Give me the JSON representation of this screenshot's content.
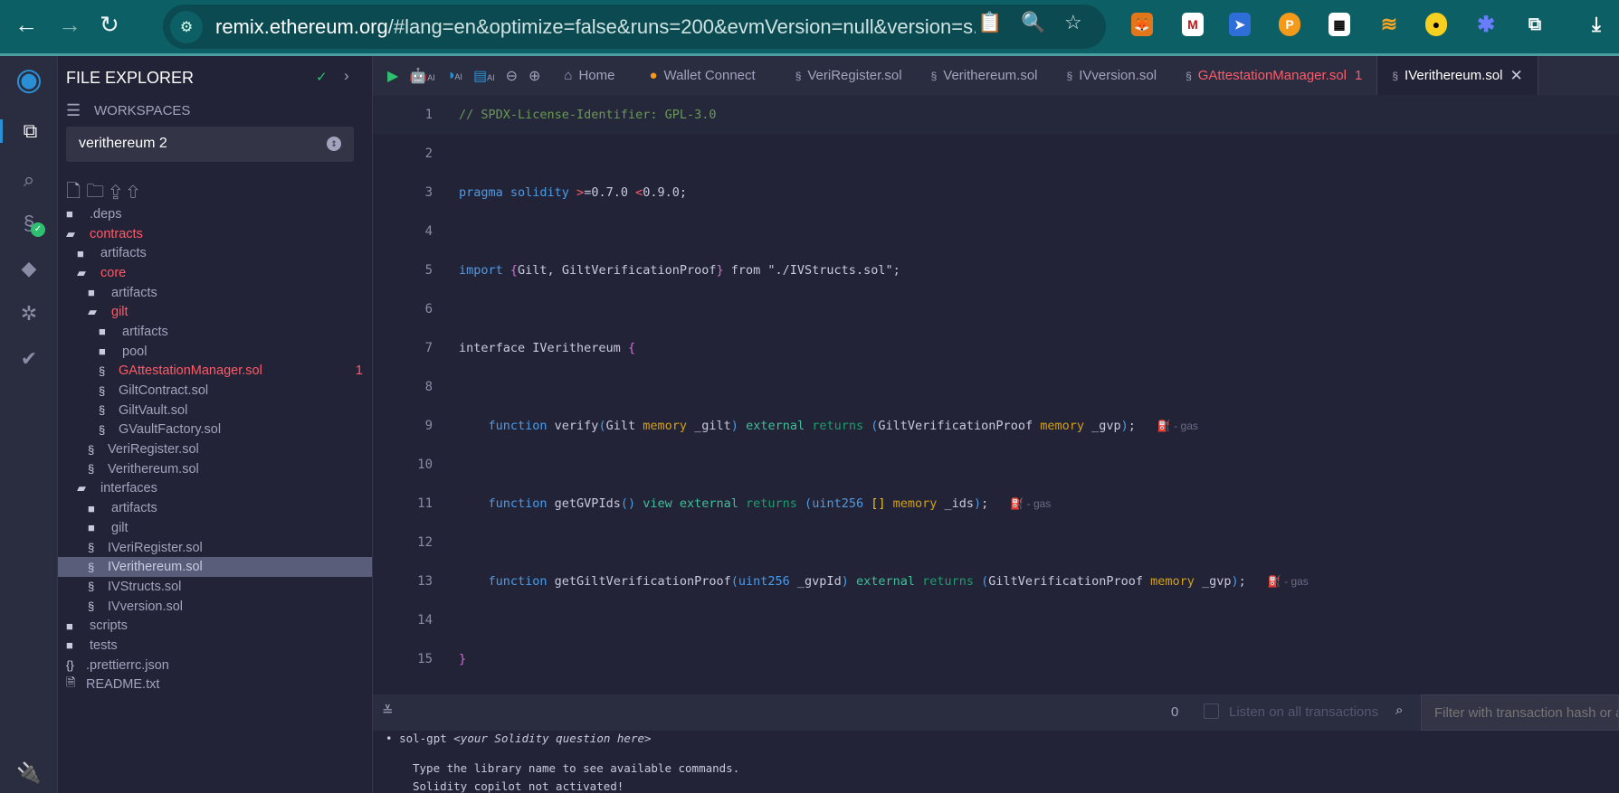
{
  "browser": {
    "url_host": "remix.ethereum.org",
    "url_rest": "/#lang=en&optimize=false&runs=200&evmVersion=null&version=s...",
    "extensions": [
      "metamask-icon",
      "mcafee-icon",
      "send-icon",
      "polkadot-icon",
      "qr-icon",
      "rss-icon",
      "bee-icon",
      "asterisk-icon",
      "puzzle-icon"
    ]
  },
  "explorer": {
    "title": "FILE EXPLORER",
    "workspaces_label": "WORKSPACES",
    "workspace": "verithereum 2",
    "tree": [
      {
        "name": ".deps",
        "type": "folder",
        "depth": 0
      },
      {
        "name": "contracts",
        "type": "folder-open",
        "depth": 0,
        "error": true
      },
      {
        "name": "artifacts",
        "type": "folder",
        "depth": 1
      },
      {
        "name": "core",
        "type": "folder-open",
        "depth": 1,
        "error": true
      },
      {
        "name": "artifacts",
        "type": "folder",
        "depth": 2
      },
      {
        "name": "gilt",
        "type": "folder-open",
        "depth": 2,
        "error": true
      },
      {
        "name": "artifacts",
        "type": "folder",
        "depth": 3
      },
      {
        "name": "pool",
        "type": "folder",
        "depth": 3
      },
      {
        "name": "GAttestationManager.sol",
        "type": "sol",
        "depth": 3,
        "error": true,
        "badge": "1"
      },
      {
        "name": "GiltContract.sol",
        "type": "sol",
        "depth": 3
      },
      {
        "name": "GiltVault.sol",
        "type": "sol",
        "depth": 3
      },
      {
        "name": "GVaultFactory.sol",
        "type": "sol",
        "depth": 3
      },
      {
        "name": "VeriRegister.sol",
        "type": "sol",
        "depth": 2
      },
      {
        "name": "Verithereum.sol",
        "type": "sol",
        "depth": 2
      },
      {
        "name": "interfaces",
        "type": "folder-open",
        "depth": 1
      },
      {
        "name": "artifacts",
        "type": "folder",
        "depth": 2
      },
      {
        "name": "gilt",
        "type": "folder",
        "depth": 2
      },
      {
        "name": "IVeriRegister.sol",
        "type": "sol",
        "depth": 2
      },
      {
        "name": "IVerithereum.sol",
        "type": "sol",
        "depth": 2,
        "selected": true
      },
      {
        "name": "IVStructs.sol",
        "type": "sol",
        "depth": 2
      },
      {
        "name": "IVversion.sol",
        "type": "sol",
        "depth": 2
      },
      {
        "name": "scripts",
        "type": "folder",
        "depth": 0
      },
      {
        "name": "tests",
        "type": "folder",
        "depth": 0
      },
      {
        "name": ".prettierrc.json",
        "type": "json",
        "depth": 0
      },
      {
        "name": "README.txt",
        "type": "file",
        "depth": 0
      }
    ]
  },
  "toolbar": {
    "ai_label": "AI",
    "home": "Home",
    "wallet": "Wallet Connect"
  },
  "tabs": [
    {
      "label": "VeriRegister.sol"
    },
    {
      "label": "Verithereum.sol"
    },
    {
      "label": "IVversion.sol"
    },
    {
      "label": "GAttestationManager.sol",
      "error": true,
      "badge": "1"
    },
    {
      "label": "IVerithereum.sol",
      "active": true
    }
  ],
  "colors": {
    "comment": "#6a9955",
    "keyword": "#4d9be6",
    "type": "#c8cadf",
    "storage": "#d4a017",
    "modifier": "#3fbf9a",
    "returns": "#1e9e6e",
    "op": "#ff5a67",
    "brace": "#d16fd1",
    "paren": "#4d9be6",
    "string": "#c8a0a0",
    "bracket": "#f0c419"
  },
  "code": [
    [
      [
        "// SPDX-License-Identifier: GPL-3.0",
        "comment"
      ]
    ],
    [],
    [
      [
        "pragma solidity ",
        "keyword"
      ],
      [
        ">",
        "op"
      ],
      [
        "=0.7.0 ",
        "type"
      ],
      [
        "<",
        "op"
      ],
      [
        "0.9.0;",
        "type"
      ]
    ],
    [],
    [
      [
        "import ",
        "keyword"
      ],
      [
        "{",
        "brace"
      ],
      [
        "Gilt, GiltVerificationProof",
        "type"
      ],
      [
        "}",
        "brace"
      ],
      [
        " from \"./IVStructs.sol\";",
        "type"
      ]
    ],
    [],
    [
      [
        "interface IVerithereum ",
        "type"
      ],
      [
        "{",
        "brace"
      ]
    ],
    [],
    [
      [
        "    function ",
        "keyword"
      ],
      [
        "verify",
        "type"
      ],
      [
        "(",
        "paren"
      ],
      [
        "Gilt ",
        "type"
      ],
      [
        "memory",
        "storage"
      ],
      [
        " _gilt",
        "type"
      ],
      [
        ")",
        "paren"
      ],
      [
        " external",
        "modifier"
      ],
      [
        " returns ",
        "returns"
      ],
      [
        "(",
        "paren"
      ],
      [
        "GiltVerificationProof ",
        "type"
      ],
      [
        "memory",
        "storage"
      ],
      [
        " _gvp",
        "type"
      ],
      [
        ")",
        "paren"
      ],
      [
        ";",
        "type"
      ]
    ],
    [],
    [
      [
        "    function ",
        "keyword"
      ],
      [
        "getGVPIds",
        "type"
      ],
      [
        "()",
        "paren"
      ],
      [
        " view external",
        "modifier"
      ],
      [
        " returns ",
        "returns"
      ],
      [
        "(",
        "paren"
      ],
      [
        "uint256 ",
        "keyword"
      ],
      [
        "[]",
        "bracket"
      ],
      [
        " memory",
        "storage"
      ],
      [
        " _ids",
        "type"
      ],
      [
        ")",
        "paren"
      ],
      [
        ";",
        "type"
      ]
    ],
    [],
    [
      [
        "    function ",
        "keyword"
      ],
      [
        "getGiltVerificationProof",
        "type"
      ],
      [
        "(",
        "paren"
      ],
      [
        "uint256",
        "keyword"
      ],
      [
        " _gvpId",
        "type"
      ],
      [
        ")",
        "paren"
      ],
      [
        " external",
        "modifier"
      ],
      [
        " returns ",
        "returns"
      ],
      [
        "(",
        "paren"
      ],
      [
        "GiltVerificationProof ",
        "type"
      ],
      [
        "memory",
        "storage"
      ],
      [
        " _gvp",
        "type"
      ],
      [
        ")",
        "paren"
      ],
      [
        ";",
        "type"
      ]
    ],
    [],
    [
      [
        "}",
        "brace"
      ]
    ]
  ],
  "gas_label": "- gas",
  "gas_lines": [
    9,
    11,
    13
  ],
  "terminal": {
    "count": "0",
    "listen_label": "Listen on all transactions",
    "filter_placeholder": "Filter with transaction hash or address",
    "bullet": "sol-gpt",
    "bullet_hint": "<your Solidity question here>",
    "lines": [
      "Type the library name to see available commands.",
      "Solidity copilot not activated!"
    ]
  }
}
